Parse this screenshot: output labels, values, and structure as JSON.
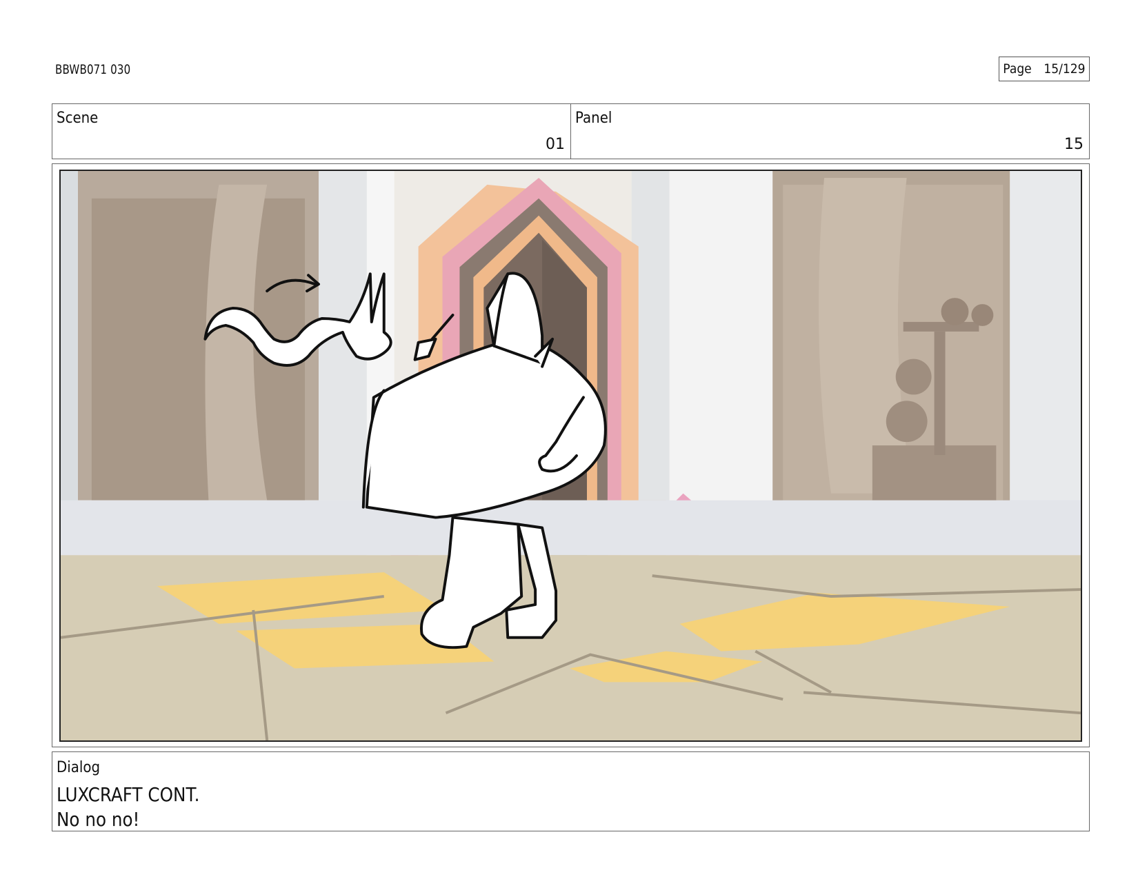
{
  "header": {
    "doc_id": "BBWB071 030",
    "page_label": "Page",
    "page_number": "15/129"
  },
  "meta": {
    "scene_label": "Scene",
    "scene_value": "01",
    "panel_label": "Panel",
    "panel_value": "15"
  },
  "dialog": {
    "label": "Dialog",
    "speaker": "LUXCRAFT CONT.",
    "line": "No no no!"
  },
  "colors": {
    "floor_glow": "#f5d27a",
    "pink_accent": "#e9a0b5",
    "orange_accent": "#f2b37a"
  }
}
